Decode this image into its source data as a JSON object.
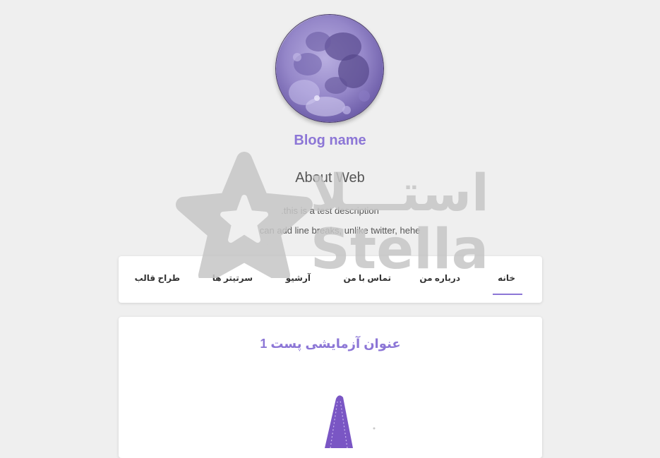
{
  "header": {
    "blog_name": "Blog name",
    "about_title": "About Web",
    "description_lines": [
      ".this is a test description",
      ".you can add line breaks, unlike twitter, hehe"
    ]
  },
  "nav": {
    "items": [
      {
        "label": "خانه",
        "active": true
      },
      {
        "label": "درباره من",
        "active": false
      },
      {
        "label": "تماس با من",
        "active": false
      },
      {
        "label": "آرشیو",
        "active": false
      },
      {
        "label": "سرتیتر ها",
        "active": false
      },
      {
        "label": "طراح قالب",
        "active": false
      }
    ]
  },
  "post": {
    "title": "عنوان آزمایشی پست 1"
  },
  "watermark": {
    "brand_fa": "استـــلا",
    "brand_en": "Stella"
  },
  "colors": {
    "accent": "#8c76d6",
    "background": "#efefef",
    "card": "#ffffff"
  }
}
